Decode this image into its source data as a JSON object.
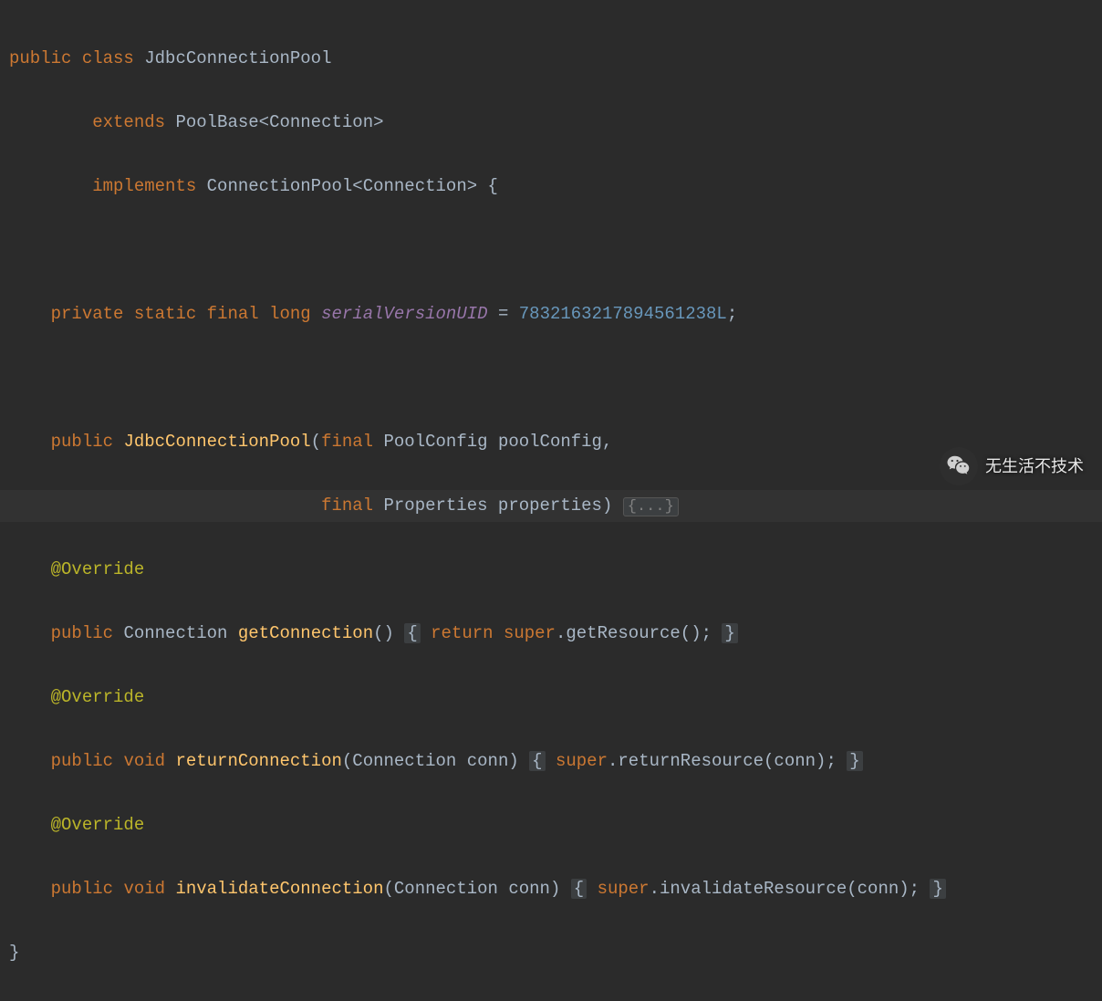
{
  "code": {
    "l1": {
      "kw1": "public",
      "kw2": "class",
      "name": "JdbcConnectionPool"
    },
    "l2": {
      "kw": "extends",
      "base": "PoolBase",
      "lt": "<",
      "gen": "Connection",
      "gt": ">"
    },
    "l3": {
      "kw": "implements",
      "iface": "ConnectionPool",
      "lt": "<",
      "gen": "Connection",
      "gt": "> {"
    },
    "l5": {
      "m1": "private",
      "m2": "static",
      "m3": "final",
      "t": "long",
      "field": "serialVersionUID",
      "eq": " = ",
      "val": "7832163217894561238L",
      "end": ";"
    },
    "l7": {
      "m": "public",
      "ctor": "JdbcConnectionPool",
      "lp": "(",
      "fin": "final",
      "t1": "PoolConfig",
      "p1": "poolConfig",
      "c": ","
    },
    "l8": {
      "fin": "final",
      "t2": "Properties",
      "p2": "properties",
      "rp": ") ",
      "fold": "{...}"
    },
    "l9": {
      "ann": "@Override"
    },
    "l10": {
      "m": "public",
      "ret": "Connection",
      "name": "getConnection",
      "sig": "() ",
      "lb": "{",
      "kw": " return ",
      "sup": "super",
      "dot": ".",
      "call": "getResource()",
      "end": "; ",
      "rb": "}"
    },
    "l11": {
      "ann": "@Override"
    },
    "l12": {
      "m": "public",
      "ret": "void",
      "name": "returnConnection",
      "lp": "(",
      "pt": "Connection",
      "pn": "conn",
      "rp": ") ",
      "lb": "{",
      "sp": " ",
      "sup": "super",
      "dot": ".",
      "call": "returnResource(conn)",
      "end": "; ",
      "rb": "}"
    },
    "l13": {
      "ann": "@Override"
    },
    "l14": {
      "m": "public",
      "ret": "void",
      "name": "invalidateConnection",
      "lp": "(",
      "pt": "Connection",
      "pn": "conn",
      "rp": ") ",
      "lb": "{",
      "sp": " ",
      "sup": "super",
      "dot": ".",
      "call": "invalidateResource(conn)",
      "end": "; ",
      "rb": "}"
    },
    "l15": {
      "brace": "}"
    }
  },
  "watermark": {
    "text": "无生活不技术"
  }
}
